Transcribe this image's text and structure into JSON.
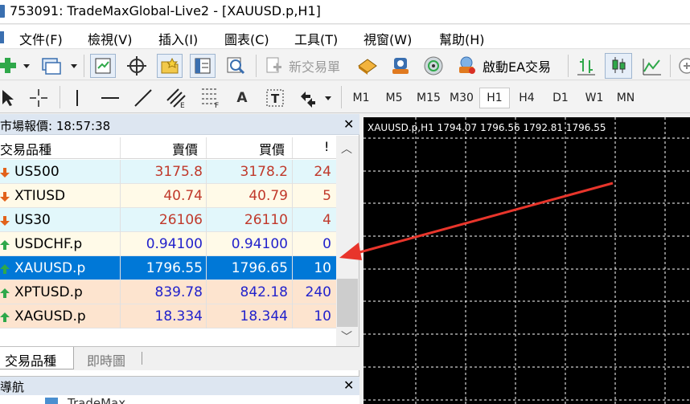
{
  "window": {
    "title": "753091: TradeMaxGlobal-Live2 - [XAUUSD.p,H1]"
  },
  "menu": {
    "items": [
      {
        "label": "文件(F)"
      },
      {
        "label": "檢視(V)"
      },
      {
        "label": "插入(I)"
      },
      {
        "label": "圖表(C)"
      },
      {
        "label": "工具(T)"
      },
      {
        "label": "視窗(W)"
      },
      {
        "label": "幫助(H)"
      }
    ]
  },
  "toolbar": {
    "new_order_label": "新交易單",
    "ea_label": "啟動EA交易"
  },
  "timeframes": [
    "M1",
    "M5",
    "M15",
    "M30",
    "H1",
    "H4",
    "D1",
    "W1",
    "MN"
  ],
  "active_timeframe": "H1",
  "market_watch": {
    "header": "市場報價: 18:57:38",
    "columns": {
      "symbol": "交易品種",
      "bid": "賣價",
      "ask": "買價",
      "spread": "!"
    },
    "rows": [
      {
        "symbol": "US500",
        "bid": "3175.8",
        "ask": "3178.2",
        "spread": "24",
        "direction": "down",
        "color": "#c0392b",
        "bg": "#e2f7fb"
      },
      {
        "symbol": "XTIUSD",
        "bid": "40.74",
        "ask": "40.79",
        "spread": "5",
        "direction": "down",
        "color": "#c0392b",
        "bg": "#fffae8"
      },
      {
        "symbol": "US30",
        "bid": "26106",
        "ask": "26110",
        "spread": "4",
        "direction": "down",
        "color": "#c0392b",
        "bg": "#e2f7fb"
      },
      {
        "symbol": "USDCHF.p",
        "bid": "0.94100",
        "ask": "0.94100",
        "spread": "0",
        "direction": "up",
        "color": "#2222cc",
        "bg": "#fffae8"
      },
      {
        "symbol": "XAUUSD.p",
        "bid": "1796.55",
        "ask": "1796.65",
        "spread": "10",
        "direction": "up",
        "color": "#ffffff",
        "bg": "#0078d7",
        "selected": true
      },
      {
        "symbol": "XPTUSD.p",
        "bid": "839.78",
        "ask": "842.18",
        "spread": "240",
        "direction": "up",
        "color": "#2222cc",
        "bg": "#fde4cf"
      },
      {
        "symbol": "XAGUSD.p",
        "bid": "18.334",
        "ask": "18.344",
        "spread": "10",
        "direction": "up",
        "color": "#2222cc",
        "bg": "#fde4cf"
      }
    ],
    "tabs": [
      {
        "label": "交易品種",
        "active": true
      },
      {
        "label": "即時圖",
        "active": false
      }
    ]
  },
  "navigator": {
    "header": "導航",
    "item_label": "TradeMax..."
  },
  "chart": {
    "info": "XAUUSD.p,H1  1794.07 1796.56 1792.81 1796.55",
    "background": "#000000",
    "grid_color": "#ffffff"
  },
  "accent_colors": {
    "selection": "#0078d7",
    "annotation_arrow": "#e8352b",
    "up_arrow": "#2fa84a",
    "down_arrow": "#e2621b"
  }
}
